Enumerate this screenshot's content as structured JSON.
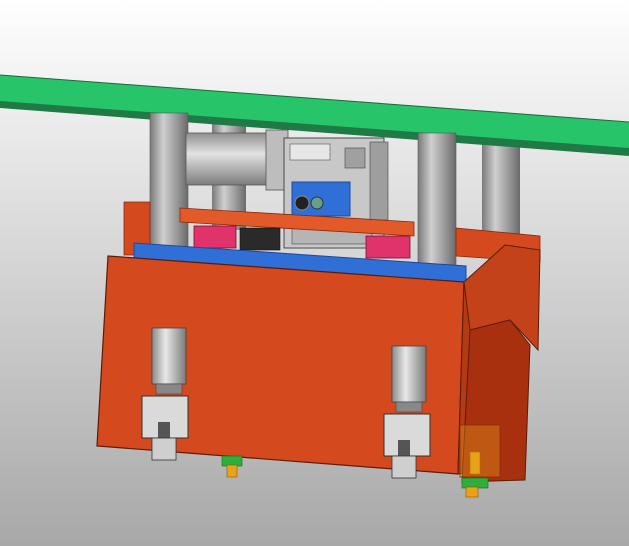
{
  "viewport": {
    "background_top": "#ffffff",
    "background_bottom": "#a8a8a8"
  },
  "colors": {
    "green_beam": "#27c46a",
    "green_beam_dark": "#1f7a45",
    "orange_body": "#d4491e",
    "orange_dark": "#a8300f",
    "orange_light": "#e35a2a",
    "blue_plate": "#2f6fd6",
    "blue_dark": "#1a4aa0",
    "steel": "#9a9a9a",
    "steel_dark": "#6e6e6e",
    "steel_light": "#cfcfcf",
    "pink_block": "#e0336b",
    "yellow_fitting": "#e9a21a",
    "green_fitting": "#2fae3a"
  },
  "icons": {
    "model": "cad-assembly-model",
    "cylinder": "pneumatic-cylinder-icon",
    "motor": "gear-motor-icon"
  }
}
